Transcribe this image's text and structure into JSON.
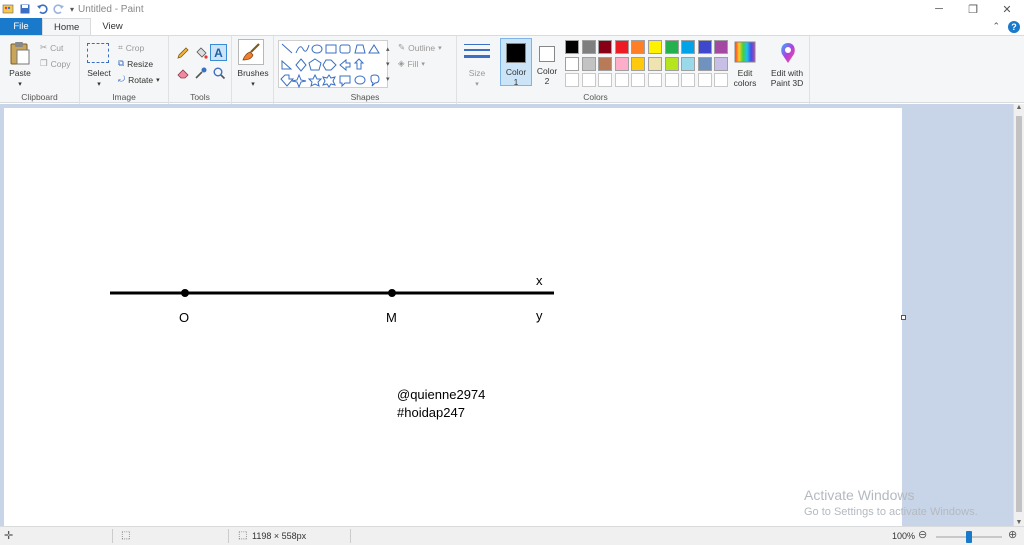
{
  "title_bar": {
    "title": "Untitled - Paint"
  },
  "tabs": [
    {
      "label": "File"
    },
    {
      "label": "Home"
    },
    {
      "label": "View"
    }
  ],
  "ribbon": {
    "clipboard": {
      "group": "Clipboard",
      "paste": "Paste",
      "cut": "Cut",
      "copy": "Copy"
    },
    "image": {
      "group": "Image",
      "select": "Select",
      "crop": "Crop",
      "resize": "Resize",
      "rotate": "Rotate"
    },
    "tools": {
      "group": "Tools"
    },
    "brushes": {
      "label": "Brushes"
    },
    "shapes": {
      "group": "Shapes",
      "outline": "Outline",
      "fill": "Fill"
    },
    "size": {
      "label": "Size"
    },
    "color1": {
      "label_line1": "Color",
      "label_line2": "1",
      "value": "#000000"
    },
    "color2": {
      "label_line1": "Color",
      "label_line2": "2",
      "value": "#ffffff"
    },
    "colors": {
      "group": "Colors",
      "row1": [
        "#000000",
        "#7f7f7f",
        "#880015",
        "#ed1c24",
        "#ff7f27",
        "#fff200",
        "#22b14c",
        "#00a2e8",
        "#3f48cc",
        "#a349a4"
      ],
      "row2": [
        "#ffffff",
        "#c3c3c3",
        "#b97a57",
        "#ffaec9",
        "#ffc90e",
        "#efe4b0",
        "#b5e61d",
        "#99d9ea",
        "#7092be",
        "#c8bfe7"
      ],
      "edit_line1": "Edit",
      "edit_line2": "colors"
    },
    "paint3d": {
      "label_line1": "Edit with",
      "label_line2": "Paint 3D"
    }
  },
  "drawing": {
    "labels": {
      "o": "O",
      "m": "M",
      "x": "x",
      "y": "y"
    },
    "watermark_line1": "@quienne2974",
    "watermark_line2": "#hoidap247"
  },
  "activation": {
    "line1": "Activate Windows",
    "line2": "Go to Settings to activate Windows."
  },
  "status_bar": {
    "dimensions": "1198 × 558px",
    "zoom": "100%",
    "zoom_level": 0.5
  }
}
